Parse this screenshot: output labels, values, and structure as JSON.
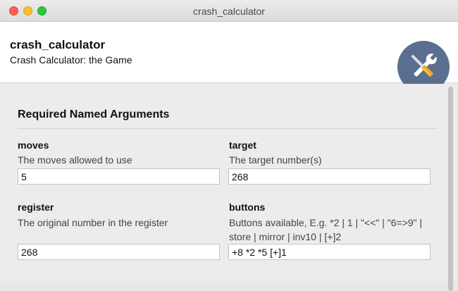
{
  "window": {
    "title": "crash_calculator"
  },
  "header": {
    "app_name": "crash_calculator",
    "app_description": "Crash Calculator: the Game",
    "icon": "tools-icon",
    "icon_bg_color": "#5a6f8f"
  },
  "section": {
    "title": "Required Named Arguments"
  },
  "fields": {
    "moves": {
      "label": "moves",
      "help": "The moves allowed to use",
      "value": "5"
    },
    "target": {
      "label": "target",
      "help": "The target number(s)",
      "value": "268"
    },
    "register": {
      "label": "register",
      "help": "The original number in the register",
      "value": "268"
    },
    "buttons": {
      "label": "buttons",
      "help": "Buttons available, E.g. *2 | 1 | \"<<\" | \"6=>9\" | store | mirror | inv10 | [+]2",
      "value": "+8 *2 *5 [+]1"
    }
  },
  "colors": {
    "close": "#fd5f57",
    "minimize": "#fcbc2e",
    "maximize": "#29c840"
  }
}
